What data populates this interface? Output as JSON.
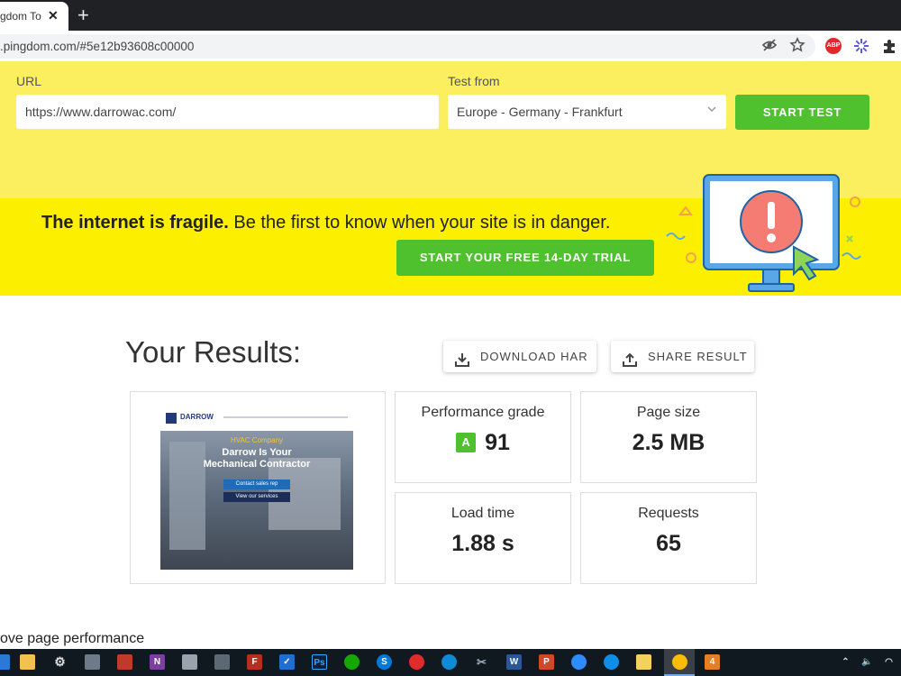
{
  "browser": {
    "tab_title": "gdom To",
    "tab_close": "✕",
    "new_tab": "+",
    "url": ".pingdom.com/#5e12b93608c00000",
    "extensions": [
      "ABP"
    ]
  },
  "form": {
    "url_label": "URL",
    "url_value": "https://www.darrowac.com/",
    "test_from_label": "Test from",
    "test_from_value": "Europe - Germany - Frankfurt",
    "start_button": "START TEST"
  },
  "banner": {
    "bold_text": "The internet is fragile.",
    "text": " Be the first to know when your site is in danger.",
    "trial_button": "START YOUR FREE 14-DAY TRIAL"
  },
  "results": {
    "title": "Your Results:",
    "download_button": "DOWNLOAD HAR",
    "share_button": "SHARE RESULT",
    "cards": {
      "performance": {
        "label": "Performance grade",
        "grade": "A",
        "value": "91",
        "grade_color": "#4fc12e"
      },
      "page_size": {
        "label": "Page size",
        "value": "2.5 MB"
      },
      "load_time": {
        "label": "Load time",
        "value": "1.88 s"
      },
      "requests": {
        "label": "Requests",
        "value": "65"
      }
    }
  },
  "thumbnail": {
    "logo": "DARROW",
    "headline_1": "Darrow Is Your",
    "headline_2": "Mechanical Contractor",
    "kicker": "HVAC Company",
    "cta_1": "Contact sales rep",
    "cta_2": "View our services"
  },
  "footer_text": "ove page performance",
  "colors": {
    "form_bg": "#fbee5f",
    "banner_bg": "#fdef00",
    "accent": "#4fc12e"
  }
}
